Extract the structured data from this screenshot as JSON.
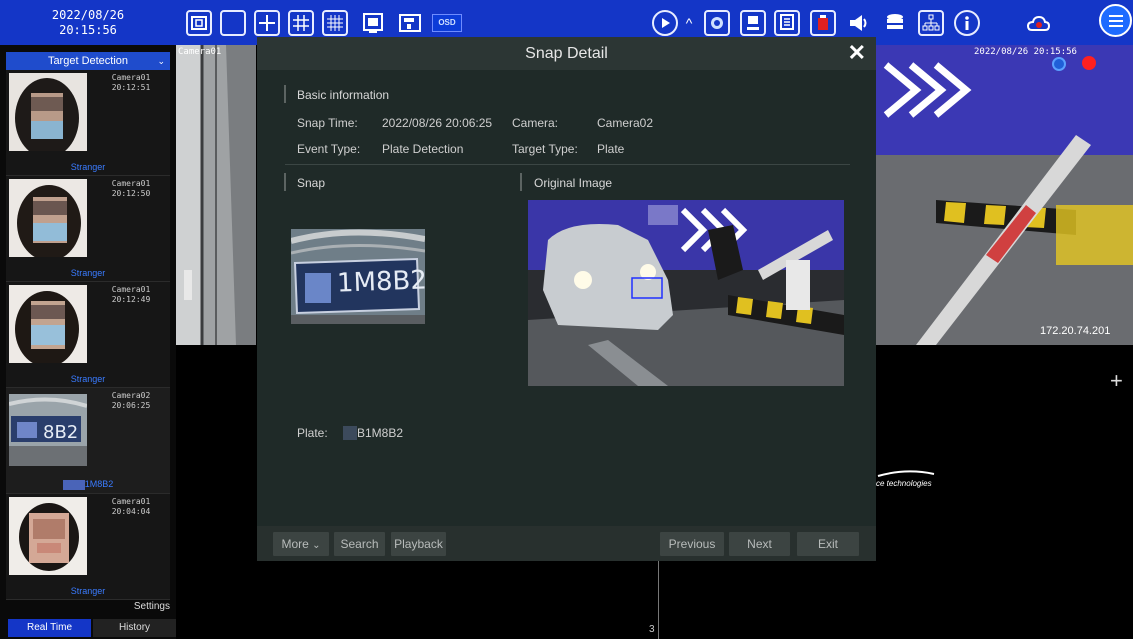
{
  "clock": {
    "date": "2022/08/26",
    "time": "20:15:56"
  },
  "toolbar": {
    "osd_label": "OSD"
  },
  "left_panel": {
    "dropdown_label": "Target Detection",
    "items": [
      {
        "camera": "Camera01",
        "time": "20:12:51",
        "label": "Stranger"
      },
      {
        "camera": "Camera01",
        "time": "20:12:50",
        "label": "Stranger"
      },
      {
        "camera": "Camera01",
        "time": "20:12:49",
        "label": "Stranger"
      },
      {
        "camera": "Camera02",
        "time": "20:06:25",
        "label": "1M8B2"
      },
      {
        "camera": "Camera01",
        "time": "20:04:04",
        "label": "Stranger"
      }
    ],
    "settings_label": "Settings",
    "tabs": {
      "realtime": "Real Time",
      "history": "History"
    }
  },
  "video": {
    "cell1_name": "Camera01",
    "cell2_timestamp": "2022/08/26 20:15:56",
    "cell2_ip": "172.20.74.201",
    "brand_text": "ce technologies",
    "cell_number": "3"
  },
  "modal": {
    "title": "Snap Detail",
    "basic_info_title": "Basic information",
    "snap_time_label": "Snap Time:",
    "snap_time_value": "2022/08/26 20:06:25",
    "camera_label": "Camera:",
    "camera_value": "Camera02",
    "event_type_label": "Event Type:",
    "event_type_value": "Plate Detection",
    "target_type_label": "Target Type:",
    "target_type_value": "Plate",
    "snap_title": "Snap",
    "original_title": "Original Image",
    "snap_plate_text": "1M8B2",
    "plate_label": "Plate:",
    "plate_value": "B1M8B2",
    "buttons": {
      "more": "More",
      "search": "Search",
      "playback": "Playback",
      "previous": "Previous",
      "next": "Next",
      "exit": "Exit"
    }
  },
  "colors": {
    "topbar": "#1436c7",
    "accent_blue": "#3a7bff",
    "modal_bg": "#1f2a28"
  }
}
